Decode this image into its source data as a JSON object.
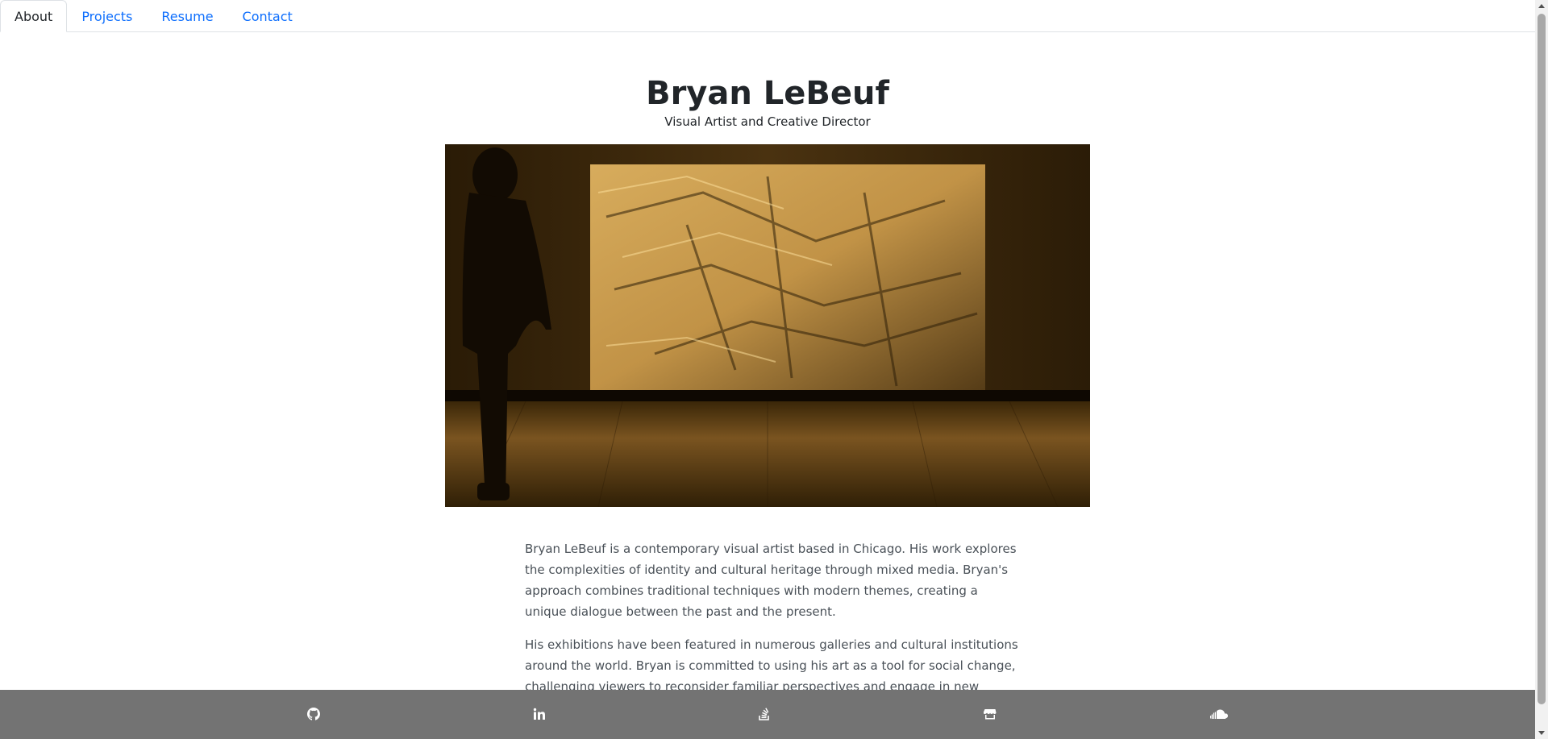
{
  "tabs": [
    {
      "label": "About",
      "active": true
    },
    {
      "label": "Projects",
      "active": false
    },
    {
      "label": "Resume",
      "active": false
    },
    {
      "label": "Contact",
      "active": false
    }
  ],
  "header": {
    "name": "Bryan LeBeuf",
    "subtitle": "Visual Artist and Creative Director"
  },
  "hero": {
    "icon": "gallery-photo"
  },
  "bio": {
    "paragraphs": [
      "Bryan LeBeuf is a contemporary visual artist based in Chicago. His work explores the complexities of identity and cultural heritage through mixed media. Bryan's approach combines traditional techniques with modern themes, creating a unique dialogue between the past and the present.",
      "His exhibitions have been featured in numerous galleries and cultural institutions around the world. Bryan is committed to using his art as a tool for social change, challenging viewers to reconsider familiar perspectives and engage in new dialogues."
    ]
  },
  "footer": {
    "icons": [
      "github-icon",
      "linkedin-icon",
      "stack-overflow-icon",
      "store-icon",
      "soundcloud-icon"
    ]
  },
  "colors": {
    "link": "#0d6efd",
    "footer_bg": "#737373",
    "text": "#212529",
    "body_text": "#495057"
  }
}
